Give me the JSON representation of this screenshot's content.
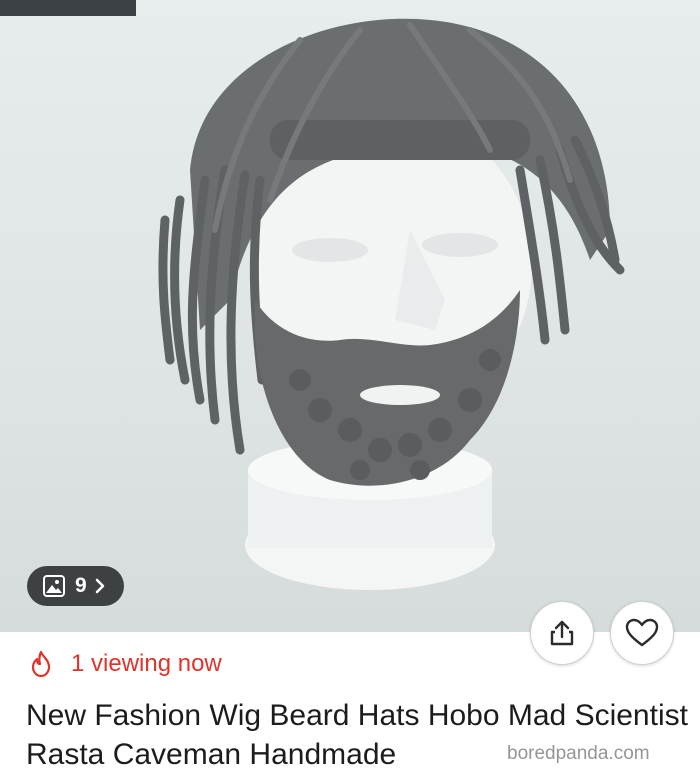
{
  "gallery": {
    "count": "9",
    "image_icon": "image-icon",
    "chevron_icon": "chevron-right-icon"
  },
  "actions": {
    "share_icon": "share-icon",
    "like_icon": "heart-icon"
  },
  "viewing": {
    "icon": "flame-icon",
    "text": "1 viewing now",
    "color": "#e0332c"
  },
  "product": {
    "title": "New Fashion Wig Beard Hats Hobo Mad Scientist Rasta Caveman Handmade"
  },
  "watermark": {
    "text": "boredpanda.com"
  }
}
